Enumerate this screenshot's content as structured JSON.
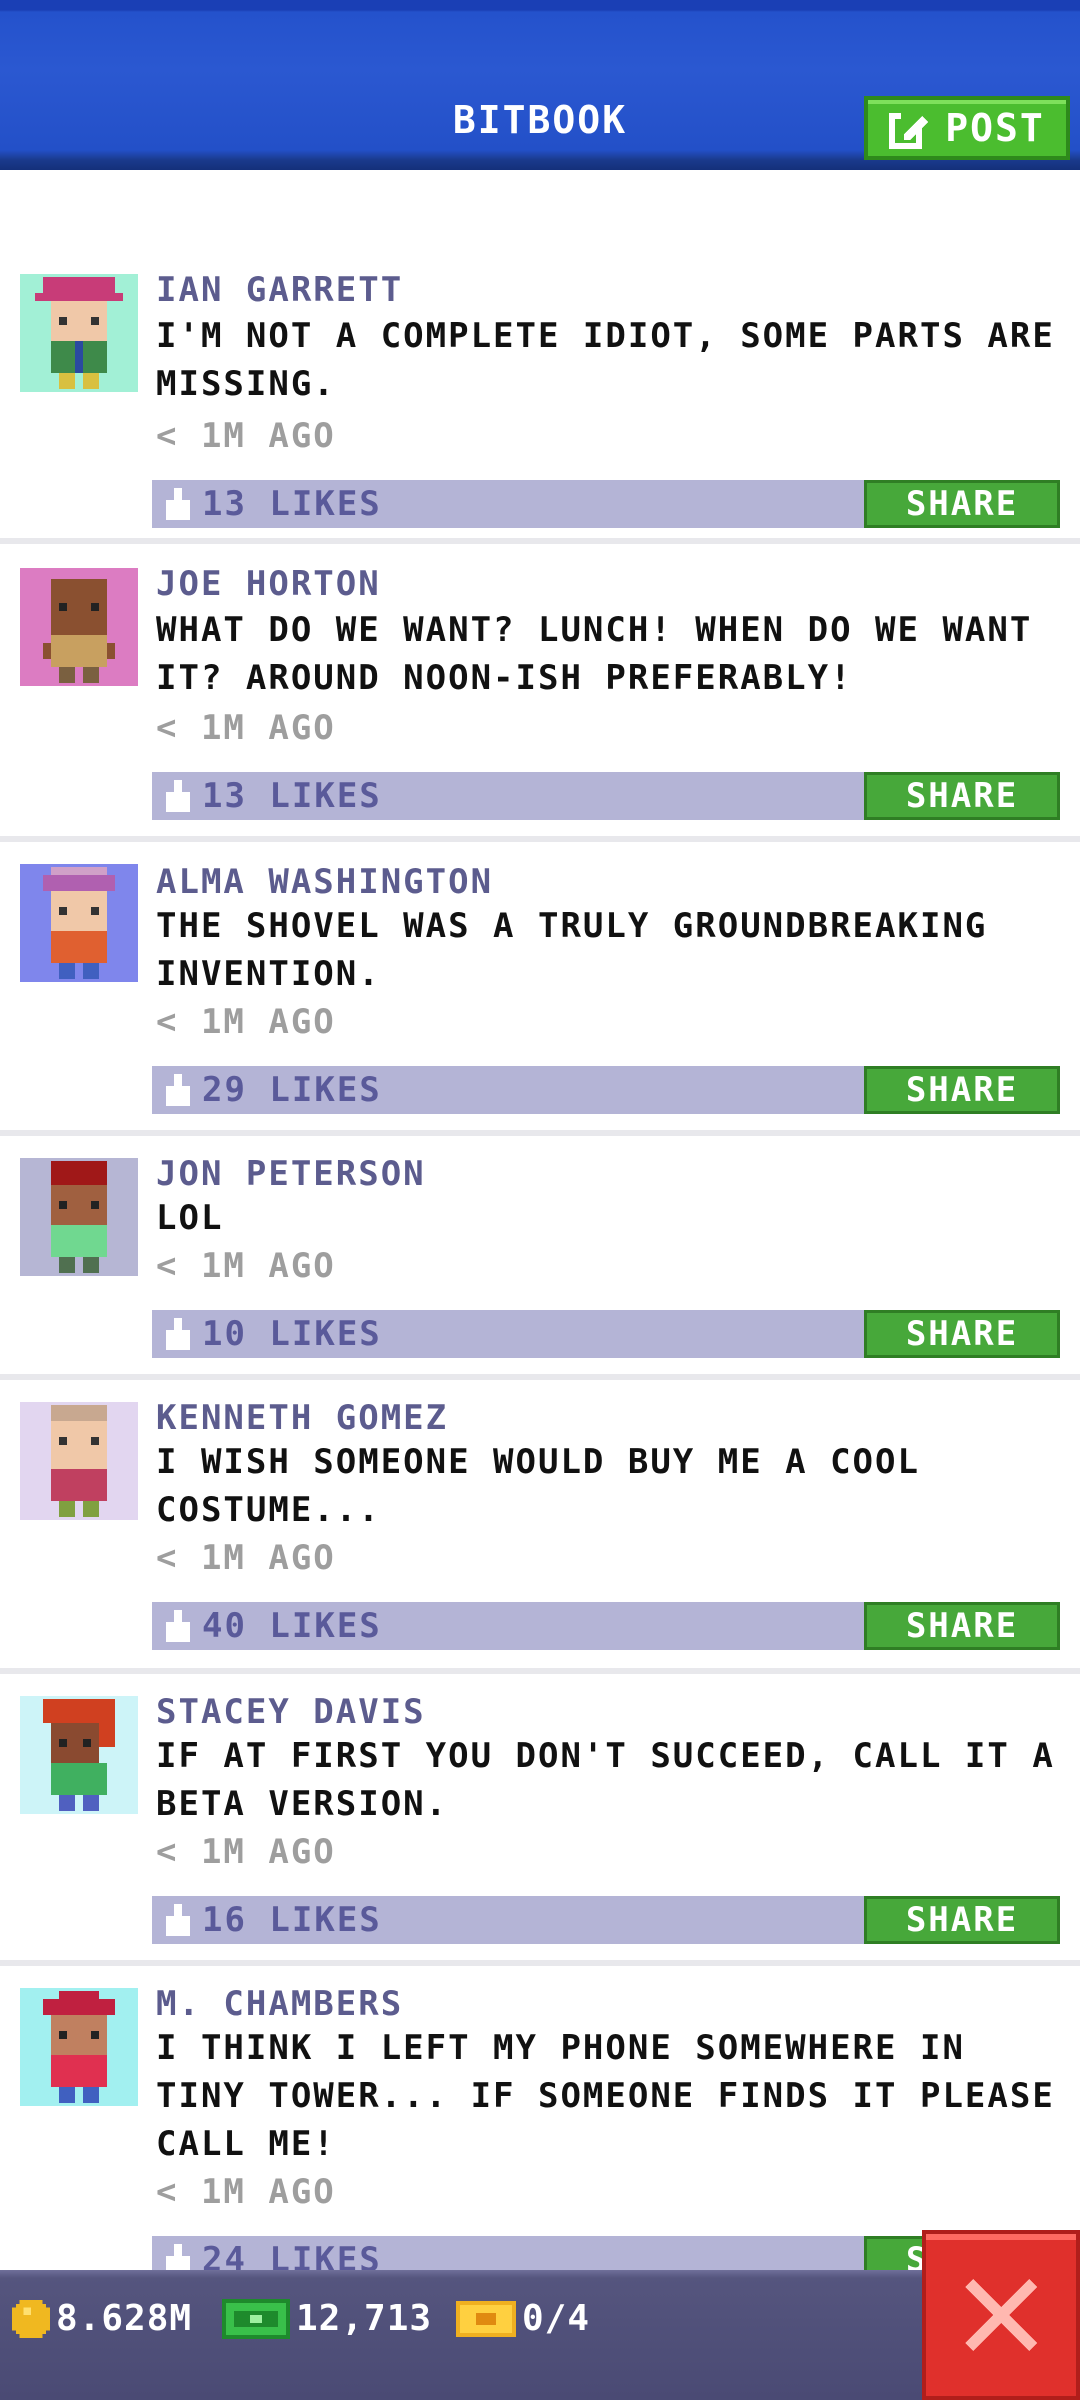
{
  "header": {
    "title": "BITBOOK",
    "post_label": "POST"
  },
  "posts": [
    {
      "name": "IAN GARRETT",
      "text": "I'M NOT A COMPLETE IDIOT, SOME PARTS ARE MISSING.",
      "time": "< 1M AGO",
      "likes": "13 LIKES",
      "share_label": "SHARE",
      "avatar_bg": "#a2f0d6"
    },
    {
      "name": "JOE HORTON",
      "text": "WHAT DO WE WANT? LUNCH! WHEN DO WE WANT IT? AROUND NOON-ISH PREFERABLY!",
      "time": "< 1M AGO",
      "likes": "13 LIKES",
      "share_label": "SHARE",
      "avatar_bg": "#dc7cc2"
    },
    {
      "name": "ALMA WASHINGTON",
      "text": "THE SHOVEL WAS A TRULY GROUNDBREAKING INVENTION.",
      "time": "< 1M AGO",
      "likes": "29 LIKES",
      "share_label": "SHARE",
      "avatar_bg": "#7f86ec"
    },
    {
      "name": "JON PETERSON",
      "text": "LOL",
      "time": "< 1M AGO",
      "likes": "10 LIKES",
      "share_label": "SHARE",
      "avatar_bg": "#b6b6d4"
    },
    {
      "name": "KENNETH GOMEZ",
      "text": "I WISH SOMEONE WOULD BUY ME A COOL COSTUME...",
      "time": "< 1M AGO",
      "likes": "40 LIKES",
      "share_label": "SHARE",
      "avatar_bg": "#e2d6f0"
    },
    {
      "name": "STACEY DAVIS",
      "text": "IF AT FIRST YOU DON'T SUCCEED, CALL IT A BETA VERSION.",
      "time": "< 1M AGO",
      "likes": "16 LIKES",
      "share_label": "SHARE",
      "avatar_bg": "#cdf4f8"
    },
    {
      "name": "M. CHAMBERS",
      "text": "I THINK I LEFT MY PHONE SOMEWHERE IN TINY TOWER... IF SOMEONE FINDS IT PLEASE CALL ME!",
      "time": "< 1M AGO",
      "likes": "24 LIKES",
      "share_label": "SHARE",
      "avatar_bg": "#a2f0f0"
    }
  ],
  "status_bar": {
    "coins": "8.628M",
    "bux": "12,713",
    "tickets": "0/4"
  },
  "colors": {
    "header_blue": "#2b58d1",
    "post_green": "#4bbd2f",
    "likes_bar": "#b4b4d6",
    "name_purple": "#5c5c8e",
    "close_red": "#e0302c"
  }
}
